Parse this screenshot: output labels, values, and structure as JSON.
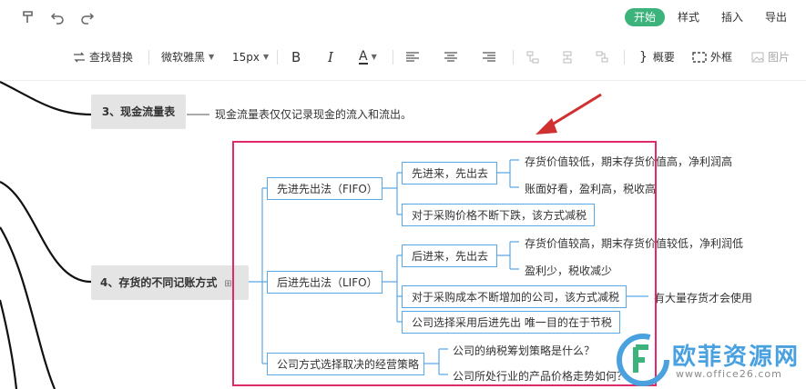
{
  "header": {
    "tabs": [
      {
        "label": "开始",
        "active": true
      },
      {
        "label": "样式"
      },
      {
        "label": "插入"
      },
      {
        "label": "导出"
      }
    ],
    "accent": "#3db37c"
  },
  "toolbar": {
    "find_replace": "查找替换",
    "font_family": "微软雅黑",
    "font_size": "15px",
    "bold": "B",
    "italic": "I",
    "font_color": "A",
    "summary": "概要",
    "frame": "外框",
    "image": "图片"
  },
  "mindmap": {
    "node3": {
      "title": "3、现金流量表",
      "note": "现金流量表仅仅记录现金的流入和流出。"
    },
    "node4": {
      "title": "4、存货的不同记账方式",
      "fifo": {
        "label": "先进先出法（FIFO）",
        "sub1": "先进来，先出去",
        "leaf1": "存货价值较低，期末存货价值高，净利润高",
        "leaf2": "账面好看，盈利高，税收高",
        "sub2": "对于采购价格不断下跌，该方式减税"
      },
      "lifo": {
        "label": "后进先出法（LIFO）",
        "sub1": "后进来，先出去",
        "leaf1": "存货价值较高，期末存货价值较低，净利润低",
        "leaf2": "盈利少，税收减少",
        "sub2": "对于采购成本不断增加的公司，该方式减税",
        "sub2_note": "有大量存货才会使用",
        "sub3": "公司选择采用后进先出 唯一目的在于节税"
      },
      "strategy": {
        "label": "公司方式选择取决的经营策略",
        "q1": "公司的纳税筹划策略是什么？",
        "q2": "公司所处行业的产品价格走势如何？"
      }
    },
    "highlight_color": "#e0286b",
    "line_color": "#5aa7e6"
  },
  "watermark": {
    "text": "欧菲资源网",
    "url": "www.office26.com"
  }
}
